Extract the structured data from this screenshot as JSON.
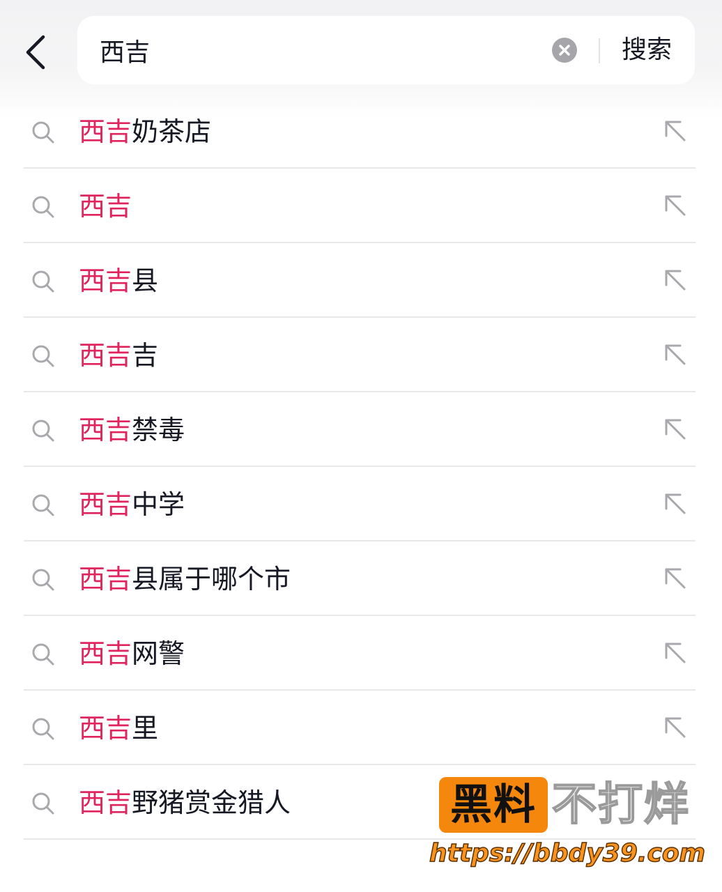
{
  "header": {
    "back_icon": "chevron-left-icon",
    "search": {
      "value": "西吉",
      "placeholder": "",
      "clear_icon": "clear-circle-icon",
      "submit_label": "搜索"
    }
  },
  "suggestions": [
    {
      "highlight": "西吉",
      "rest": "奶茶店"
    },
    {
      "highlight": "西吉",
      "rest": ""
    },
    {
      "highlight": "西吉",
      "rest": "县"
    },
    {
      "highlight": "西吉",
      "rest": "吉"
    },
    {
      "highlight": "西吉",
      "rest": "禁毒"
    },
    {
      "highlight": "西吉",
      "rest": "中学"
    },
    {
      "highlight": "西吉",
      "rest": "县属于哪个市"
    },
    {
      "highlight": "西吉",
      "rest": "网警"
    },
    {
      "highlight": "西吉",
      "rest": "里"
    },
    {
      "highlight": "西吉",
      "rest": "野猪赏金猎人"
    }
  ],
  "suggestion_icons": {
    "leading": "search-icon",
    "trailing": "arrow-up-left-icon"
  },
  "watermark": {
    "badge": "黑料",
    "title": "不打烊",
    "url": "https://bbdy39.com"
  },
  "colors": {
    "highlight": "#e0245e",
    "text": "#161823",
    "icon": "#a9a9ad",
    "divider": "#e8e8ea",
    "watermark_orange": "#f5870c"
  }
}
